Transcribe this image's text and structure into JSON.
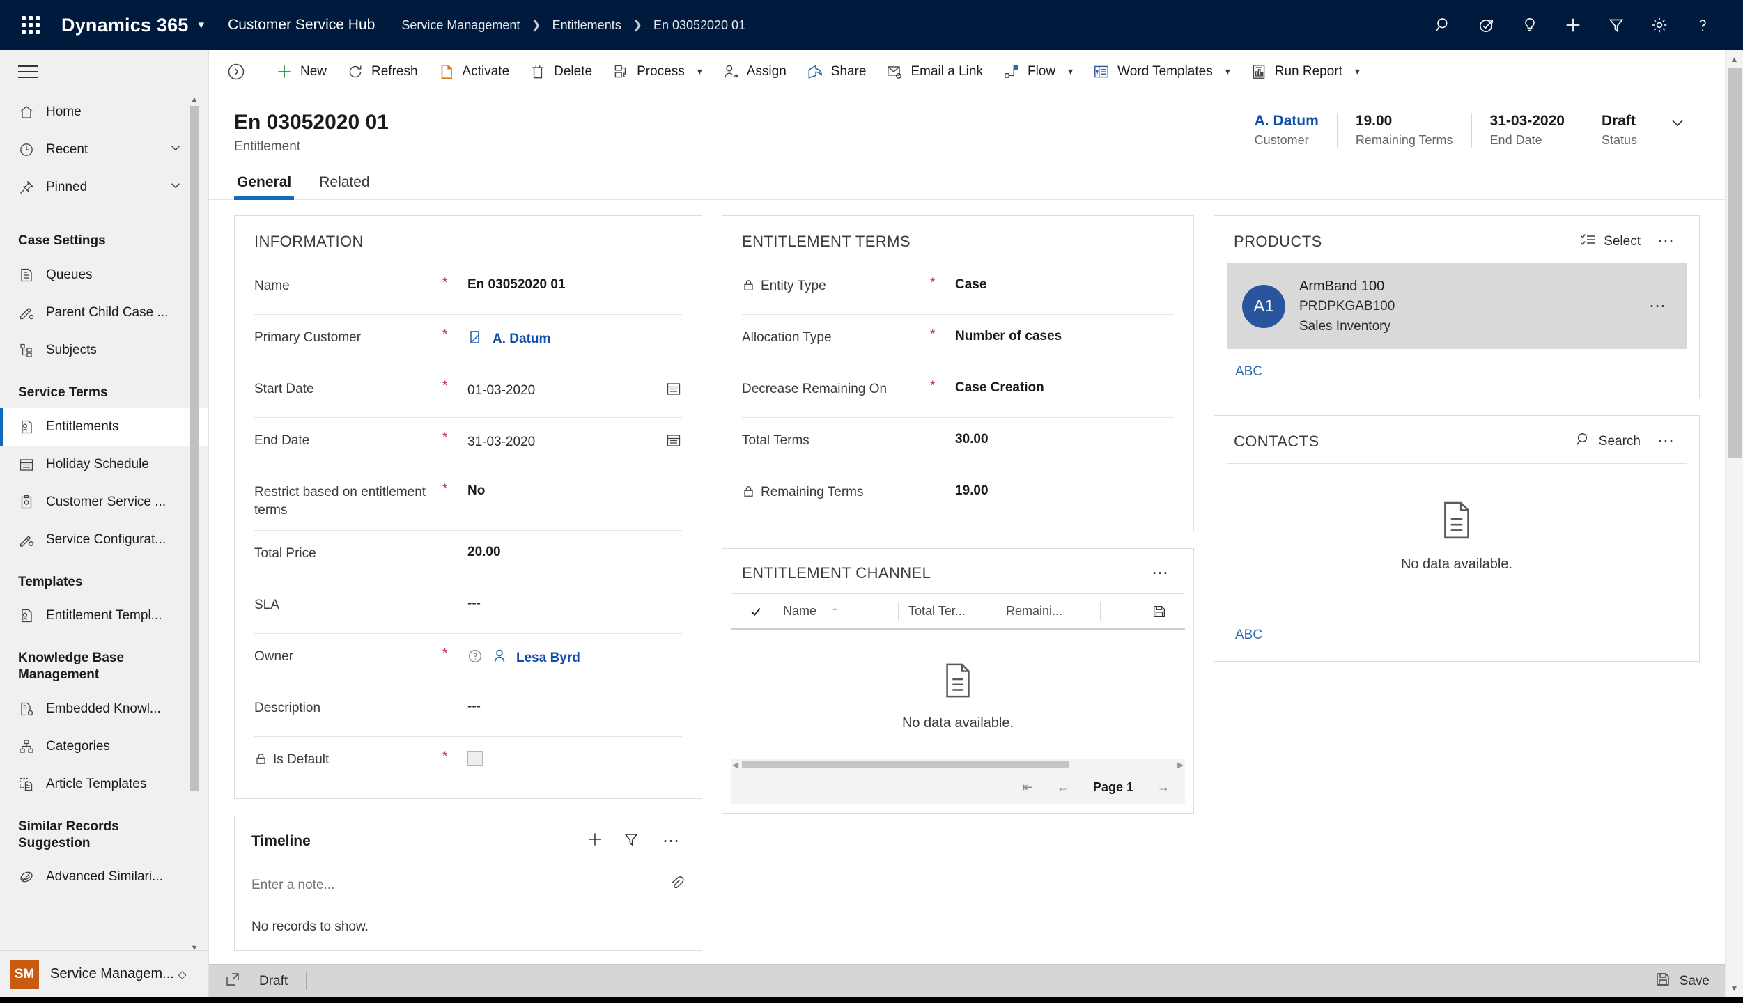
{
  "topnav": {
    "waffle_icon": "app-launcher-icon",
    "brand": "Dynamics 365",
    "brand_chevron": "chevron-down-icon",
    "app_name": "Customer Service Hub",
    "breadcrumbs": [
      "Service Management",
      "Entitlements",
      "En 03052020 01"
    ],
    "right_icons": [
      "search-icon",
      "assistant-icon",
      "insights-lightbulb-icon",
      "quick-create-plus-icon",
      "filter-icon",
      "settings-gear-icon",
      "help-question-icon"
    ]
  },
  "sidebar": {
    "hamburger": "site-map-toggle-icon",
    "top_items": [
      {
        "label": "Home",
        "icon": "home-icon",
        "chevron": false
      },
      {
        "label": "Recent",
        "icon": "recent-clock-icon",
        "chevron": true
      },
      {
        "label": "Pinned",
        "icon": "pin-icon",
        "chevron": true
      }
    ],
    "groups": [
      {
        "title": "Case Settings",
        "items": [
          {
            "label": "Queues",
            "icon": "queue-icon"
          },
          {
            "label": "Parent Child Case ...",
            "icon": "parent-child-case-settings-icon"
          },
          {
            "label": "Subjects",
            "icon": "subjects-hierarchy-icon"
          }
        ]
      },
      {
        "title": "Service Terms",
        "items": [
          {
            "label": "Entitlements",
            "icon": "entitlement-icon",
            "selected": true
          },
          {
            "label": "Holiday Schedule",
            "icon": "calendar-icon"
          },
          {
            "label": "Customer Service ...",
            "icon": "customer-service-schedule-icon"
          },
          {
            "label": "Service Configurat...",
            "icon": "service-configuration-icon"
          }
        ]
      },
      {
        "title": "Templates",
        "items": [
          {
            "label": "Entitlement Templ...",
            "icon": "entitlement-template-icon"
          }
        ]
      },
      {
        "title": "Knowledge Base Management",
        "items": [
          {
            "label": "Embedded Knowl...",
            "icon": "embedded-knowledge-icon"
          },
          {
            "label": "Categories",
            "icon": "categories-icon"
          },
          {
            "label": "Article Templates",
            "icon": "article-template-icon"
          }
        ]
      },
      {
        "title": "Similar Records Suggestion",
        "items": [
          {
            "label": "Advanced Similari...",
            "icon": "advanced-similarity-icon"
          }
        ]
      }
    ],
    "footer": {
      "badge": "SM",
      "label": "Service Managem...",
      "chevron": "area-switcher-chevron-icon"
    },
    "scrollbar": {
      "up": "scroll-up-icon",
      "down": "scroll-down-icon"
    }
  },
  "commandbar": {
    "collapse_icon": "collapse-panel-icon",
    "buttons": [
      {
        "label": "New",
        "icon": "plus-icon",
        "chevron": false
      },
      {
        "label": "Refresh",
        "icon": "refresh-icon",
        "chevron": false
      },
      {
        "label": "Activate",
        "icon": "activate-icon",
        "chevron": false
      },
      {
        "label": "Delete",
        "icon": "trash-icon",
        "chevron": false
      },
      {
        "label": "Process",
        "icon": "process-icon",
        "chevron": true
      },
      {
        "label": "Assign",
        "icon": "assign-person-icon",
        "chevron": false
      },
      {
        "label": "Share",
        "icon": "share-icon",
        "chevron": false
      },
      {
        "label": "Email a Link",
        "icon": "email-link-icon",
        "chevron": false
      },
      {
        "label": "Flow",
        "icon": "flow-icon",
        "chevron": true
      },
      {
        "label": "Word Templates",
        "icon": "word-template-icon",
        "chevron": true
      },
      {
        "label": "Run Report",
        "icon": "run-report-icon",
        "chevron": true
      }
    ]
  },
  "record": {
    "title": "En 03052020 01",
    "subtitle": "Entitlement",
    "header_stats": [
      {
        "value": "A. Datum",
        "label": "Customer",
        "is_link": true
      },
      {
        "value": "19.00",
        "label": "Remaining Terms",
        "is_link": false
      },
      {
        "value": "31-03-2020",
        "label": "End Date",
        "is_link": false
      },
      {
        "value": "Draft",
        "label": "Status",
        "is_link": false
      }
    ],
    "header_chevron": "expand-header-chevron-icon",
    "tabs": [
      {
        "label": "General",
        "active": true
      },
      {
        "label": "Related",
        "active": false
      }
    ]
  },
  "information": {
    "section_title": "INFORMATION",
    "fields": [
      {
        "label": "Name",
        "required": true,
        "value": "En 03052020 01",
        "type": "text",
        "locked": false
      },
      {
        "label": "Primary Customer",
        "required": true,
        "value": "A. Datum",
        "type": "lookup",
        "icon": "account-lookup-icon",
        "locked": false
      },
      {
        "label": "Start Date",
        "required": true,
        "value": "01-03-2020",
        "type": "date",
        "icon": "calendar-icon",
        "locked": false
      },
      {
        "label": "End Date",
        "required": true,
        "value": "31-03-2020",
        "type": "date",
        "icon": "calendar-icon",
        "locked": false
      },
      {
        "label": "Restrict based on entitlement terms",
        "required": true,
        "value": "No",
        "type": "text",
        "locked": false
      },
      {
        "label": "Total Price",
        "required": false,
        "value": "20.00",
        "type": "text",
        "locked": false
      },
      {
        "label": "SLA",
        "required": false,
        "value": "---",
        "type": "muted",
        "locked": false
      },
      {
        "label": "Owner",
        "required": true,
        "value": "Lesa Byrd",
        "type": "owner",
        "icon": "user-lookup-icon",
        "help_icon": "help-circle-icon",
        "locked": false
      },
      {
        "label": "Description",
        "required": false,
        "value": "---",
        "type": "muted",
        "locked": false
      },
      {
        "label": "Is Default",
        "required": true,
        "value": "",
        "type": "checkbox",
        "locked": true
      }
    ]
  },
  "entitlement_terms": {
    "section_title": "ENTITLEMENT TERMS",
    "fields": [
      {
        "label": "Entity Type",
        "required": true,
        "value": "Case",
        "locked": true
      },
      {
        "label": "Allocation Type",
        "required": true,
        "value": "Number of cases",
        "locked": false
      },
      {
        "label": "Decrease Remaining On",
        "required": true,
        "value": "Case Creation",
        "locked": false
      },
      {
        "label": "Total Terms",
        "required": false,
        "value": "30.00",
        "locked": false
      },
      {
        "label": "Remaining Terms",
        "required": false,
        "value": "19.00",
        "locked": true
      }
    ]
  },
  "entitlement_channel": {
    "section_title": "ENTITLEMENT CHANNEL",
    "more_icon": "more-options-icon",
    "columns": [
      "Name",
      "Total Ter...",
      "Remaini..."
    ],
    "select_all_icon": "select-all-check-icon",
    "sort_icon": "sort-ascending-icon",
    "save_grid_icon": "save-grid-icon",
    "empty_text": "No data available.",
    "empty_icon": "no-data-document-icon",
    "pager": {
      "first": "first-page-icon",
      "prev": "previous-page-icon",
      "page_label": "Page 1",
      "next": "next-page-icon"
    }
  },
  "timeline": {
    "title": "Timeline",
    "add_icon": "add-timeline-record-icon",
    "filter_icon": "filter-icon",
    "more_icon": "more-options-icon",
    "note_placeholder": "Enter a note...",
    "attach_icon": "attachment-paperclip-icon",
    "empty_text": "No records to show."
  },
  "products": {
    "section_title": "PRODUCTS",
    "select_label": "Select",
    "select_icon": "select-list-icon",
    "more_icon": "more-options-icon",
    "items": [
      {
        "avatar": "A1",
        "name": "ArmBand 100",
        "code": "PRDPKGAB100",
        "category": "Sales Inventory",
        "row_more_icon": "more-options-icon"
      }
    ],
    "footer_link": "ABC"
  },
  "contacts": {
    "section_title": "CONTACTS",
    "search_label": "Search",
    "search_icon": "search-icon",
    "more_icon": "more-options-icon",
    "empty_text": "No data available.",
    "empty_icon": "no-data-document-icon",
    "footer_link": "ABC"
  },
  "statusbar": {
    "popout_icon": "pop-out-icon",
    "state": "Draft",
    "save_label": "Save",
    "save_icon": "save-floppy-icon"
  },
  "colors": {
    "navy": "#001a3d",
    "accent_blue": "#0f6cbd",
    "link_blue": "#0f4ea8",
    "required_red": "#c4314b",
    "badge_orange": "#c85a11",
    "avatar_blue": "#28559e"
  }
}
